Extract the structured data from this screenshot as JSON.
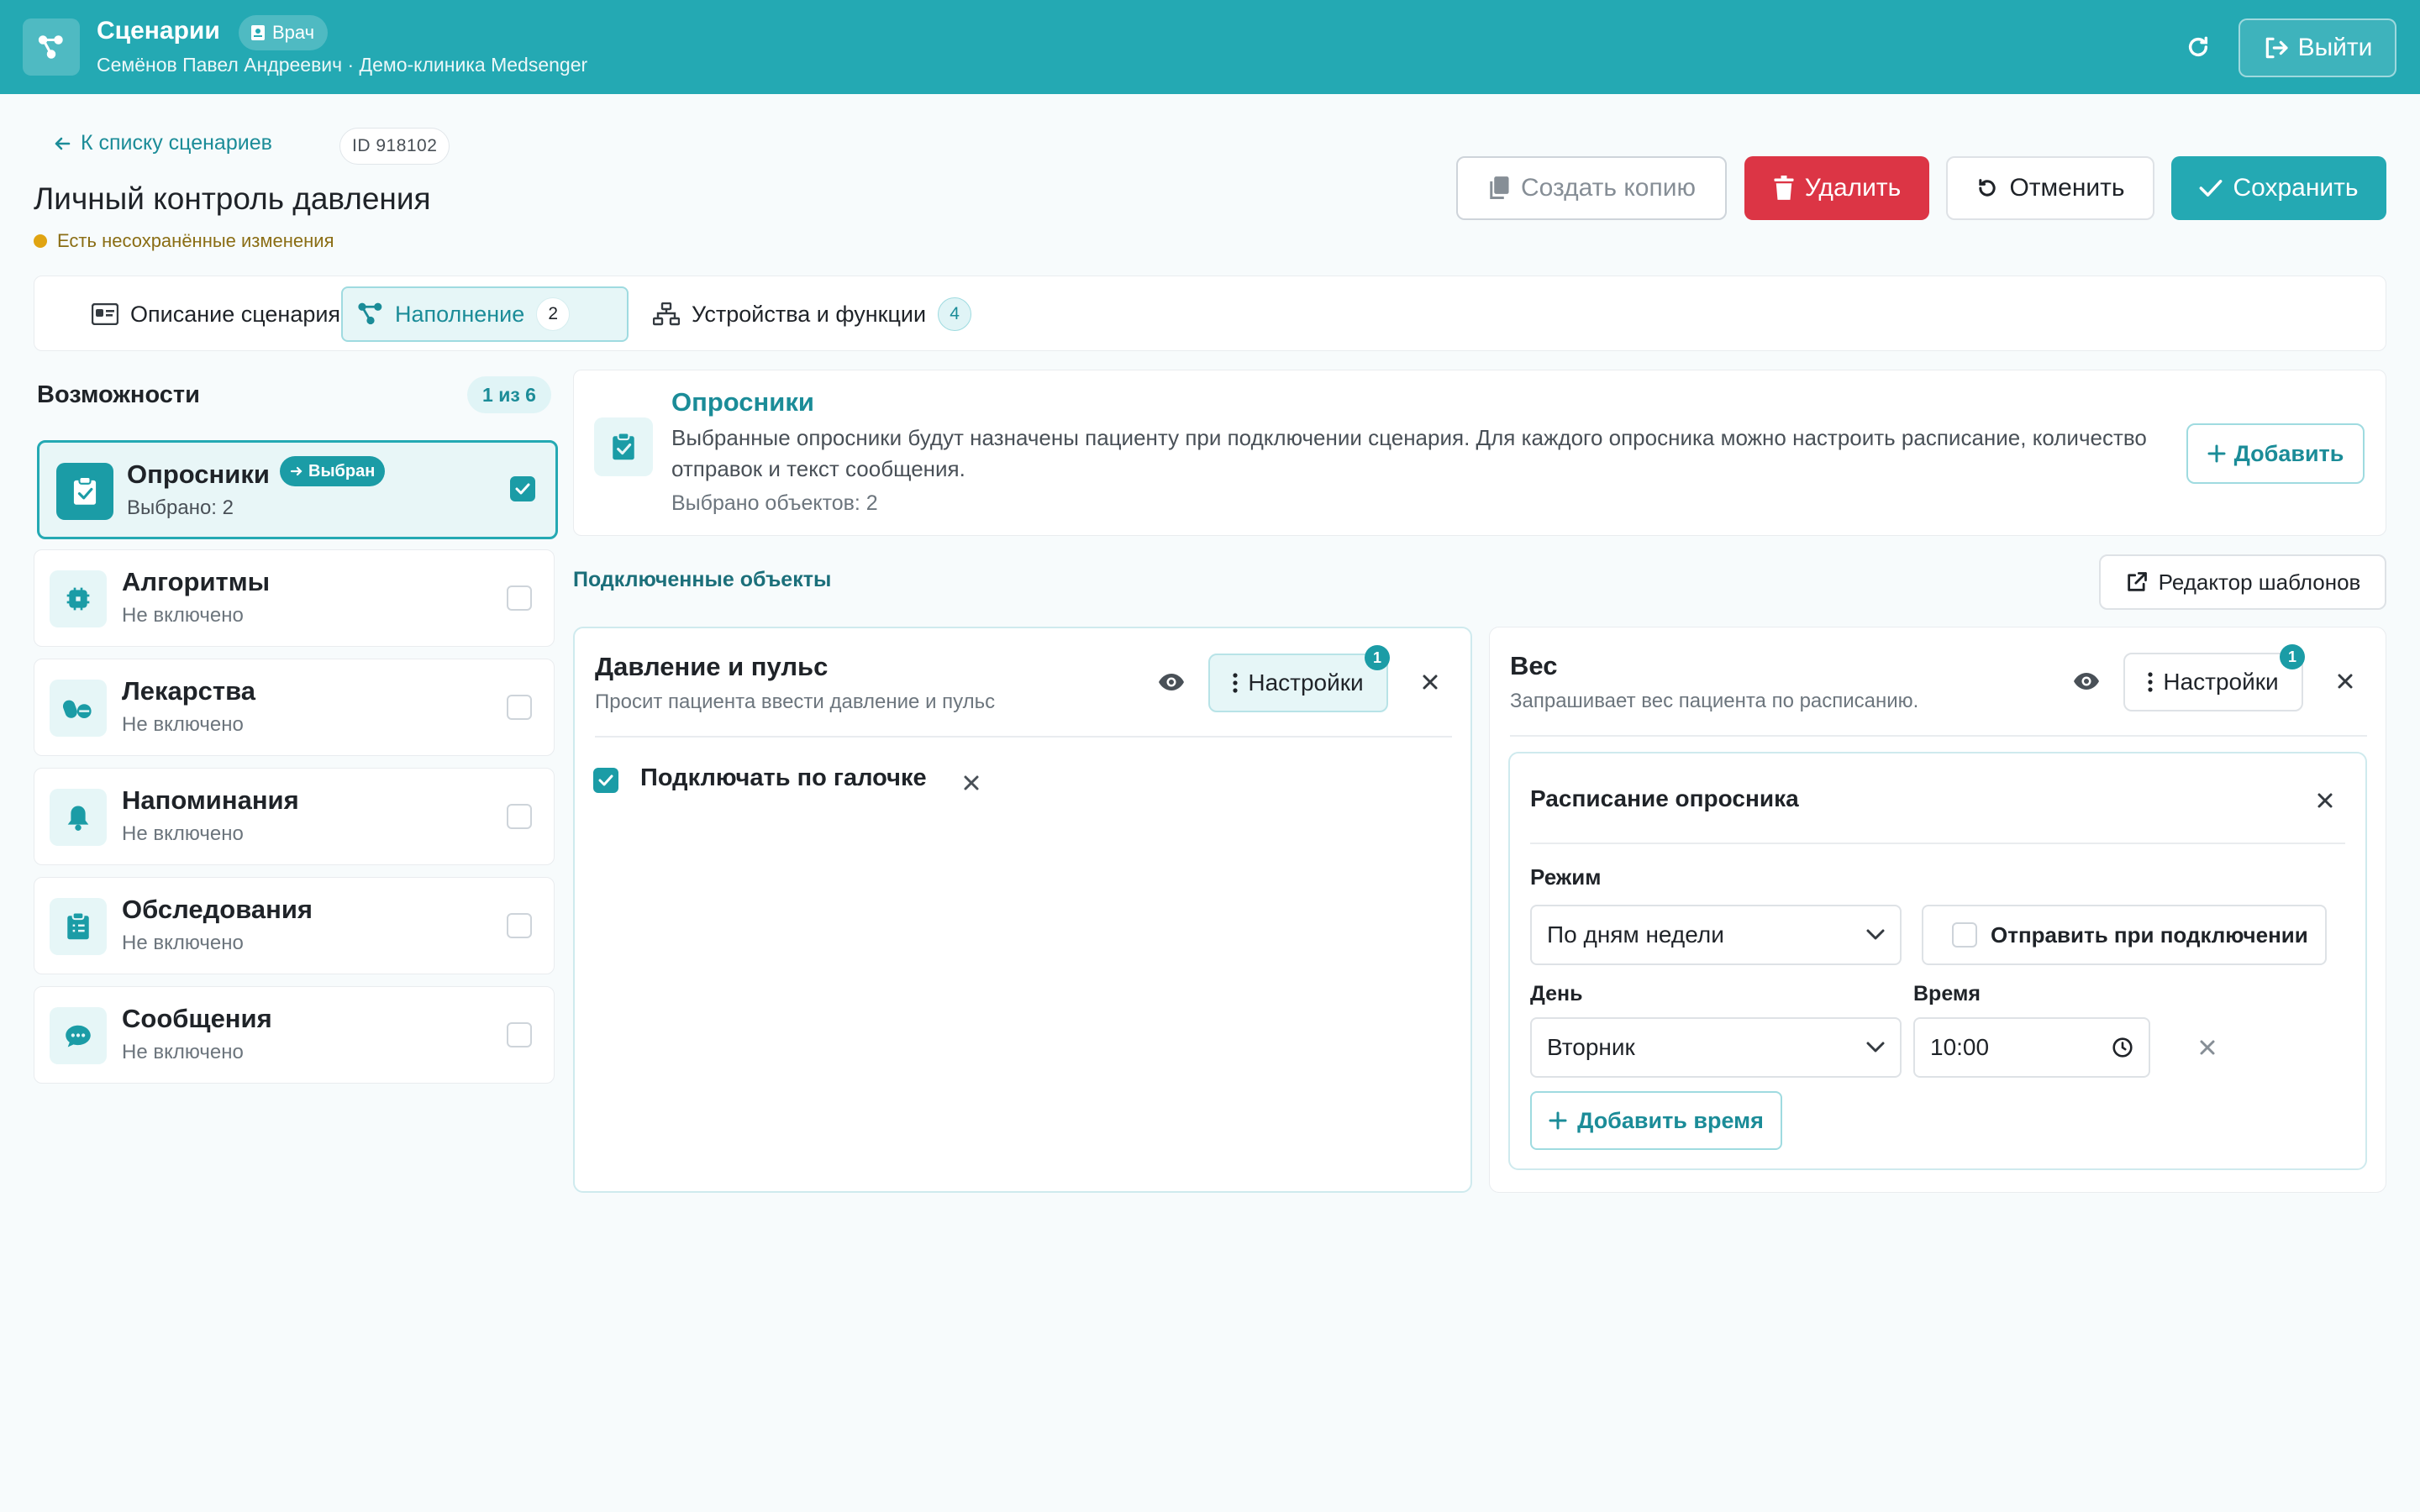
{
  "topbar": {
    "title": "Сценарии",
    "role_badge": "Врач",
    "subtitle": "Семёнов Павел Андреевич · Демо-клиника Medsenger",
    "logout_label": "Выйти"
  },
  "header": {
    "back_label": "К списку сценариев",
    "id_label": "ID 918102",
    "page_title": "Личный контроль давления",
    "unsaved_text": "Есть несохранённые изменения"
  },
  "actions": {
    "copy": "Создать копию",
    "delete": "Удалить",
    "cancel": "Отменить",
    "save": "Сохранить"
  },
  "tabs": [
    {
      "label": "Описание сценария",
      "count": null
    },
    {
      "label": "Наполнение",
      "count": "2"
    },
    {
      "label": "Устройства и функции",
      "count": "4"
    }
  ],
  "capabilities": {
    "title": "Возможности",
    "counter": "1 из 6",
    "selected_badge": "Выбран",
    "items": [
      {
        "name": "Опросники",
        "state": "Выбрано: 2",
        "checked": true,
        "icon": "clipboard-check-icon"
      },
      {
        "name": "Алгоритмы",
        "state": "Не включено",
        "checked": false,
        "icon": "cpu-icon"
      },
      {
        "name": "Лекарства",
        "state": "Не включено",
        "checked": false,
        "icon": "pills-icon"
      },
      {
        "name": "Напоминания",
        "state": "Не включено",
        "checked": false,
        "icon": "bell-icon"
      },
      {
        "name": "Обследования",
        "state": "Не включено",
        "checked": false,
        "icon": "clipboard-list-icon"
      },
      {
        "name": "Сообщения",
        "state": "Не включено",
        "checked": false,
        "icon": "chat-icon"
      }
    ]
  },
  "info": {
    "title": "Опросники",
    "description": "Выбранные опросники будут назначены пациенту при подключении сценария. Для каждого опросника можно настроить расписание, количество отправок и текст сообщения.",
    "selected_count": "Выбрано объектов: 2",
    "add_label": "Добавить"
  },
  "connected": {
    "section_label": "Подключенные объекты",
    "template_editor_label": "Редактор шаблонов",
    "settings_label": "Настройки",
    "settings_badge": "1",
    "left": {
      "title": "Давление и пульс",
      "subtitle": "Просит пациента ввести давление и пульс",
      "option_label": "Подключать по галочке"
    },
    "right": {
      "title": "Вес",
      "subtitle": "Запрашивает вес пациента по расписанию.",
      "schedule": {
        "title": "Расписание опросника",
        "mode_label": "Режим",
        "mode_value": "По дням недели",
        "send_on_connect_label": "Отправить при подключении",
        "day_label": "День",
        "day_value": "Вторник",
        "time_label": "Время",
        "time_value": "10:00",
        "add_time_label": "Добавить время"
      }
    }
  },
  "colors": {
    "brand": "#24a9b3",
    "danger": "#dc3545",
    "warning_dot": "#e0a412"
  }
}
